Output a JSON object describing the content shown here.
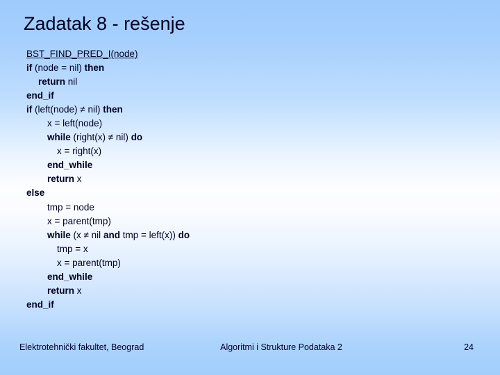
{
  "slide": {
    "title": "Zadatak 8 - rešenje",
    "page_number": "24"
  },
  "code": {
    "signature": "BST_FIND_PRED_I(node)",
    "lines": [
      {
        "indent": 0,
        "segments": [
          {
            "text": "if ",
            "bold": true
          },
          {
            "text": "(node = nil) ",
            "bold": false
          },
          {
            "text": "then",
            "bold": true
          }
        ]
      },
      {
        "indent": 1,
        "segments": [
          {
            "text": "return ",
            "bold": true
          },
          {
            "text": "nil",
            "bold": false
          }
        ]
      },
      {
        "indent": 0,
        "segments": [
          {
            "text": "end_if",
            "bold": true
          }
        ]
      },
      {
        "indent": 0,
        "segments": [
          {
            "text": "if ",
            "bold": true
          },
          {
            "text": "(left(node) ≠ nil) ",
            "bold": false
          },
          {
            "text": "then",
            "bold": true
          }
        ]
      },
      {
        "indent": 2,
        "segments": [
          {
            "text": "x = left(node)",
            "bold": false
          }
        ]
      },
      {
        "indent": 2,
        "segments": [
          {
            "text": "while ",
            "bold": true
          },
          {
            "text": "(right(x) ≠ nil) ",
            "bold": false
          },
          {
            "text": "do",
            "bold": true
          }
        ]
      },
      {
        "indent": 3,
        "segments": [
          {
            "text": "x = right(x)",
            "bold": false
          }
        ]
      },
      {
        "indent": 2,
        "segments": [
          {
            "text": "end_while",
            "bold": true
          }
        ]
      },
      {
        "indent": 2,
        "segments": [
          {
            "text": "return ",
            "bold": true
          },
          {
            "text": "x",
            "bold": false
          }
        ]
      },
      {
        "indent": 0,
        "segments": [
          {
            "text": "else",
            "bold": true
          }
        ]
      },
      {
        "indent": 2,
        "segments": [
          {
            "text": "tmp = node",
            "bold": false
          }
        ]
      },
      {
        "indent": 2,
        "segments": [
          {
            "text": "x = parent(tmp)",
            "bold": false
          }
        ]
      },
      {
        "indent": 2,
        "segments": [
          {
            "text": "while ",
            "bold": true
          },
          {
            "text": "(x ≠ nil ",
            "bold": false
          },
          {
            "text": "and ",
            "bold": true
          },
          {
            "text": "tmp = left(x)) ",
            "bold": false
          },
          {
            "text": "do",
            "bold": true
          }
        ]
      },
      {
        "indent": 3,
        "segments": [
          {
            "text": "tmp = x",
            "bold": false
          }
        ]
      },
      {
        "indent": 3,
        "segments": [
          {
            "text": "x = parent(tmp)",
            "bold": false
          }
        ]
      },
      {
        "indent": 2,
        "segments": [
          {
            "text": "end_while",
            "bold": true
          }
        ]
      },
      {
        "indent": 2,
        "segments": [
          {
            "text": "return ",
            "bold": true
          },
          {
            "text": "x",
            "bold": false
          }
        ]
      },
      {
        "indent": 0,
        "segments": [
          {
            "text": "end_if",
            "bold": true
          }
        ]
      }
    ]
  },
  "footer": {
    "institution": "Elektrotehnički fakultet, Beograd",
    "course": "Algoritmi i Strukture Podataka 2"
  },
  "colors": {
    "background_top": "#9ecbfd",
    "background_middle": "#fdfdff",
    "background_bottom": "#a3cefc",
    "text": "#000022"
  }
}
